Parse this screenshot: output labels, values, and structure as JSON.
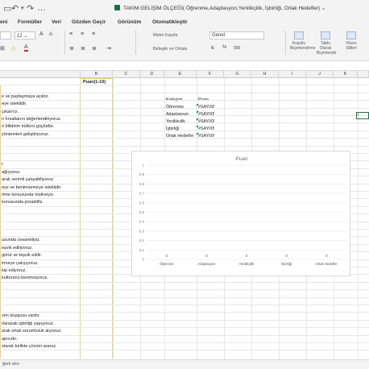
{
  "window": {
    "title": "TAKIM GELİŞİM ÖLÇEĞİ( Öğrenme,Adaptasyon,Yenilikçilik, İşbirliği, Ortak Hedefler)",
    "title_chevron": "⌄"
  },
  "tabs": [
    "eni",
    "Formüller",
    "Veri",
    "Gözden Geçir",
    "Görünüm",
    "Otomatikleştir"
  ],
  "ribbon": {
    "font_size": "12",
    "wrap_text": "Metni Kaydır",
    "merge_center": "Birleştir ve Ortala",
    "number_format": "Genel",
    "conditional_formatting": "Koşullu Biçimlendirme",
    "format_as_table": "Tablo Olarak Biçimlendir",
    "cell_styles": "Hücre Stilleri",
    "increase_font": "A",
    "decrease_font": "A",
    "font_color": "A",
    "fill_icon": "◇",
    "percent": "%",
    "thousands": "000"
  },
  "columns": [
    "B",
    "C",
    "D",
    "E",
    "F",
    "G",
    "H",
    "I",
    "J",
    "K"
  ],
  "header_cell_b": "Puan(1-10)",
  "col_a_rows": [
    "",
    "e ve paylaşmaya açıktır.",
    "eye isteklidir.",
    "çıkarırız.",
    "n fırsatlarını değerlendiriyoruz.",
    "ri bilidirim kültürü güçlüdür.",
    "yöntemleri geliştiriyoruz.",
    "",
    "",
    "",
    "r.",
    "ağlıyoruz.",
    "arak verimli çalışabiliyoruz.",
    "eye ve benimsemeye isteklidir.",
    "rtme konusunda motiveyiz.",
    "konusunda proaktifiz.",
    "",
    "",
    "",
    "",
    "usunda cesaretliyiz.",
    "eşvik ediliyoruz.",
    "görür ve teşvik edilir.",
    "irmeye çalışıyoruz.",
    "kip ediyoruz.",
    "kültürünü benimsiyoruz.",
    "",
    "",
    "",
    "",
    "ven duygusu vardır.",
    "rlanarak işbirliği yapıyoruz.",
    "arak ortak sorumluluk alıyoruz.",
    "apıcıdır.",
    "olarak birlikte çözüm aranız.",
    ""
  ],
  "summary": {
    "header_category": "Kategori",
    "header_score": "Puan",
    "rows": [
      {
        "category": "Öğrenme",
        "score": "#SAYI/0!"
      },
      {
        "category": "Adaptasyon",
        "score": "#SAYI/0!"
      },
      {
        "category": "Yenilikçilik",
        "score": "#SAYI/0!"
      },
      {
        "category": "İşbirliği",
        "score": "#SAYI/0!"
      },
      {
        "category": "Ortak Hedefler",
        "score": "#SAYI/0!"
      }
    ]
  },
  "selected_cell_text": "i",
  "chart_data": {
    "type": "bar",
    "title": "Puan",
    "categories": [
      "Öğrenme",
      "Adaptasyon",
      "Yenilikçilik",
      "İşbirliği",
      "Ortak Hedefler"
    ],
    "values": [
      0,
      0,
      0,
      0,
      0
    ],
    "data_labels": [
      "0",
      "0",
      "0",
      "0",
      "0"
    ],
    "yticks": [
      "1",
      "0.9",
      "0.8",
      "0.7",
      "0.6",
      "0.5",
      "0.4",
      "0.3",
      "0.2",
      "0.1",
      "0"
    ],
    "ylim": [
      0,
      1
    ],
    "grid": true
  },
  "statusbar": {
    "text": "ğerli alın"
  }
}
